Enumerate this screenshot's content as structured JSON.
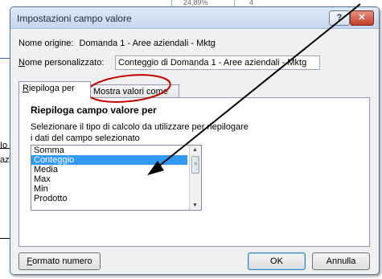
{
  "background": {
    "cells": [
      "24,89%",
      "4"
    ],
    "side_labels": [
      "Io",
      "az"
    ]
  },
  "dialog": {
    "title": "Impostazioni campo valore",
    "help_icon": "question-mark",
    "close_icon": "x",
    "source_label": "Nome origine:",
    "source_value": "Domanda 1 - Aree aziendali - Mktg",
    "custom_name_label_accel": "N",
    "custom_name_label_rest": "ome personalizzato:",
    "custom_name_value": "Conteggio di Domanda 1 - Aree aziendali - Mktg",
    "tabs": [
      {
        "accel": "R",
        "rest": "iepiloga per",
        "active": true
      },
      {
        "accel": "",
        "rest": "Mostra valori come",
        "active": false
      }
    ],
    "section_title": "Riepiloga campo valore per",
    "hint_line1": "Selezionare il tipo di calcolo da utilizzare per riepilogare",
    "hint_line2": "i dati del campo selezionato",
    "functions": [
      "Somma",
      "Conteggio",
      "Media",
      "Max",
      "Min",
      "Prodotto"
    ],
    "selected_function": "Conteggio",
    "format_button_accel": "F",
    "format_button_rest": "ormato numero",
    "ok_label": "OK",
    "cancel_label": "Annulla"
  },
  "annotations": {
    "arrow_color": "#000000",
    "circle_color": "#c00000"
  }
}
